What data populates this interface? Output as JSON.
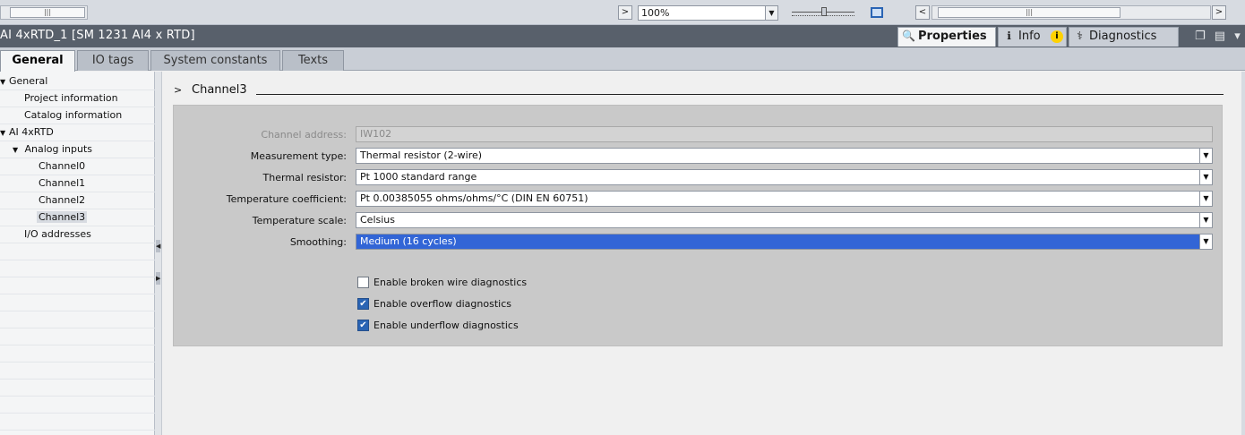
{
  "toolbar": {
    "zoom_value": "100%",
    "scroll_thumb_glyph": "|||",
    "left_arrow": "<",
    "right_arrow": ">",
    "dropdown_glyph": "▼"
  },
  "window": {
    "title": "AI 4xRTD_1 [SM 1231 AI4 x RTD]",
    "inspector_tabs": [
      {
        "label": "Properties",
        "icon": "properties-icon"
      },
      {
        "label": "Info",
        "icon": "info-icon",
        "badge": "i"
      },
      {
        "label": "Diagnostics",
        "icon": "diagnostics-icon"
      }
    ],
    "controls_glyph": "❐ ▤ ▾"
  },
  "tabs": [
    {
      "label": "General",
      "active": true
    },
    {
      "label": "IO tags",
      "active": false
    },
    {
      "label": "System constants",
      "active": false
    },
    {
      "label": "Texts",
      "active": false
    }
  ],
  "tree": [
    {
      "label": "General",
      "twisty": "▼",
      "level": 0
    },
    {
      "label": "Project information",
      "twisty": "",
      "level": 1
    },
    {
      "label": "Catalog information",
      "twisty": "",
      "level": 1
    },
    {
      "label": "AI 4xRTD",
      "twisty": "▼",
      "level": 0
    },
    {
      "label": "Analog inputs",
      "twisty": "▼",
      "level": 1
    },
    {
      "label": "Channel0",
      "twisty": "",
      "level": 2
    },
    {
      "label": "Channel1",
      "twisty": "",
      "level": 2
    },
    {
      "label": "Channel2",
      "twisty": "",
      "level": 2
    },
    {
      "label": "Channel3",
      "twisty": "",
      "level": 2,
      "selected": true
    },
    {
      "label": "I/O addresses",
      "twisty": "",
      "level": 1
    }
  ],
  "section": {
    "chevron": ">",
    "title": "Channel3"
  },
  "fields": [
    {
      "label": "Channel address:",
      "value": "IW102",
      "readonly": true
    },
    {
      "label": "Measurement type:",
      "value": "Thermal resistor (2-wire)"
    },
    {
      "label": "Thermal resistor:",
      "value": "Pt 1000 standard range"
    },
    {
      "label": "Temperature coefficient:",
      "value": "Pt 0.00385055 ohms/ohms/°C (DIN EN 60751)"
    },
    {
      "label": "Temperature scale:",
      "value": "Celsius"
    },
    {
      "label": "Smoothing:",
      "value": "Medium (16 cycles)",
      "highlight": true
    }
  ],
  "checks": [
    {
      "label": "Enable broken wire diagnostics",
      "checked": false
    },
    {
      "label": "Enable overflow diagnostics",
      "checked": true
    },
    {
      "label": "Enable underflow diagnostics",
      "checked": true
    }
  ],
  "colors": {
    "titlebar": "#58606b",
    "selection": "#3265d6",
    "checkbox_on": "#2a64b4"
  }
}
